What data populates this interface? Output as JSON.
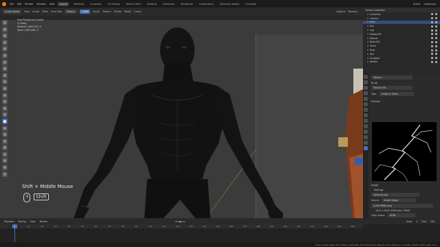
{
  "menu": {
    "items": [
      "File",
      "Edit",
      "Render",
      "Window",
      "Help"
    ],
    "tabs": [
      "Layout",
      "Modeling",
      "Sculpting",
      "UV Editing",
      "Texture Paint",
      "Shading",
      "Animation",
      "Rendering",
      "Compositing",
      "Geometry Nodes",
      "Scripting"
    ],
    "active_tab": "Layout",
    "scene": "Scene",
    "view_layer": "ViewLayer"
  },
  "header": {
    "mode": "Sculpt Mode",
    "view": "View",
    "sculpt": "Sculpt",
    "mask": "Mask",
    "face_sets": "Face Sets",
    "brush": "Brush",
    "texture": "Texture",
    "stroke": "Stroke",
    "falloff": "Falloff",
    "cursor": "Cursor",
    "radius_label": "Radius",
    "strength_label": "Strength",
    "strength_value": "1.000",
    "options": "Options",
    "remesh": "Remesh"
  },
  "stats": {
    "view": "User Perspective (Local)",
    "object": "(1) Body",
    "vertices": "Vertices  1,805,370 / 0",
    "faces": "Faces  1,805,008 / 0"
  },
  "key_hint": {
    "text": "Shift + Middle Mouse",
    "key": "Shift"
  },
  "outliner": {
    "title": "Scene Collection",
    "rows": [
      {
        "label": "Collection",
        "selected": false
      },
      {
        "label": "Camera",
        "selected": false
      },
      {
        "label": "Body",
        "selected": true
      },
      {
        "label": "Eye",
        "selected": false
      },
      {
        "label": "Leg",
        "selected": false
      },
      {
        "label": "Empty.001",
        "selected": false
      },
      {
        "label": "Helmet",
        "selected": false
      },
      {
        "label": "Body.001",
        "selected": false
      },
      {
        "label": "Plane",
        "selected": false
      },
      {
        "label": "Ring",
        "selected": false
      },
      {
        "label": "Hair",
        "selected": false
      },
      {
        "label": "Sculpted",
        "selected": false
      },
      {
        "label": "Details",
        "selected": false
      }
    ]
  },
  "properties": {
    "texture_label": "Texture",
    "texture_name": "Texture.001",
    "brush_label": "Brush",
    "type_label": "Type",
    "type_value": "Image or Movie",
    "preview_label": "Preview",
    "image_label": "Image",
    "settings_label": "Settings",
    "image_file": "lightning.png",
    "source_label": "Source",
    "source_value": "Single Image",
    "filepath": "//LIGHTNING.png",
    "resolution": "1024 x 1024, RGB byte, SRGB",
    "colorspace_label": "Color Space",
    "colorspace_value": "sRGB",
    "alpha_label": "Alpha",
    "mapping_label": "Mapping",
    "flip_axis": "Flip Axis"
  },
  "timeline": {
    "playback": "Playback",
    "keying": "Keying",
    "view": "View",
    "marker": "Marker",
    "current_frame": "1",
    "start_label": "Start",
    "start": "1",
    "end_label": "End",
    "end": "250",
    "ticks": [
      "0",
      "10",
      "20",
      "30",
      "40",
      "50",
      "60",
      "70",
      "80",
      "90",
      "100",
      "110",
      "120",
      "130",
      "140",
      "150",
      "160",
      "170",
      "180",
      "190",
      "200",
      "210",
      "220",
      "230",
      "240",
      "250"
    ]
  },
  "status": {
    "text": "Body | Verts 1,805,370 | Faces 1,805,008 | Tris 3,610,016 | Objects 1/13 | Memory 1.25 GiB | VRAM 2.6/8.0 GiB | 3.0.1"
  },
  "colors": {
    "accent": "#4772b3",
    "orange": "#e87d0d",
    "viewport_bg": "#3b3b3b"
  }
}
